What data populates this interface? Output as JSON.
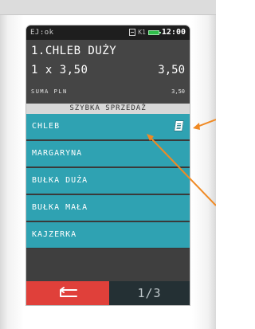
{
  "status_bar": {
    "mode": "EJ:ok",
    "printer_label": "K1",
    "time": "12:00"
  },
  "display": {
    "item_name": "1.CHLEB DUŻY",
    "quantity_line": "1 x 3,50",
    "line_total": "3,50",
    "sum_label": "SUMA PLN",
    "sum_value": "3,50"
  },
  "quick_sale": {
    "header": "SZYBKA SPRZEDAŻ",
    "items": [
      {
        "label": "CHLEB",
        "icon": "document-icon"
      },
      {
        "label": "MARGARYNA"
      },
      {
        "label": "BUŁKA DUŻA"
      },
      {
        "label": "BUŁKA MAŁA"
      },
      {
        "label": "KAJZERKA"
      }
    ]
  },
  "bottom_bar": {
    "back_icon": "back-arrow-icon",
    "page_indicator": "1/3"
  },
  "colors": {
    "button": "#2fa2b2",
    "back": "#e0403a",
    "pointer": "#f08a24"
  }
}
